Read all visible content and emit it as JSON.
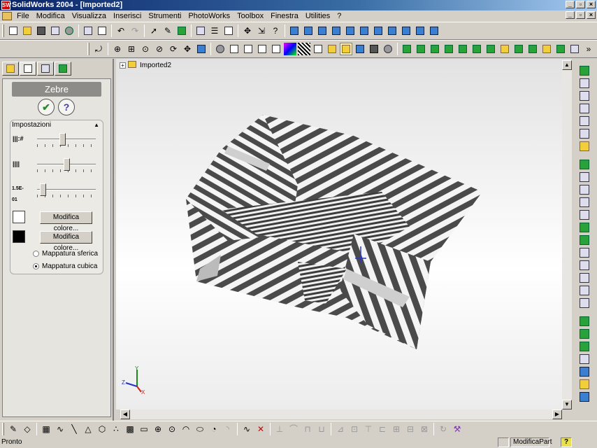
{
  "window": {
    "title": "SolidWorks 2004 - [Imported2]",
    "app_icon": "solidworks-logo-icon"
  },
  "menu": {
    "items": [
      "File",
      "Modifica",
      "Visualizza",
      "Inserisci",
      "Strumenti",
      "PhotoWorks",
      "Toolbox",
      "Finestra",
      "Utilities",
      "?"
    ]
  },
  "tree": {
    "root_label": "Imported2"
  },
  "property_manager": {
    "title": "Zebre",
    "ok_glyph": "✔",
    "help_glyph": "?",
    "group_title": "Impostazioni",
    "slider1_icon_text": "|||:#",
    "slider2_icon_text": "||||",
    "slider3_icon_text": "1.5E-01",
    "slider1_value": 0.42,
    "slider2_value": 0.5,
    "slider3_value": 0.05,
    "color1_button": "Modifica colore...",
    "color2_button": "Modifica colore...",
    "color1": "#ffffff",
    "color2": "#000000",
    "radio_spherical": "Mappatura sferica",
    "radio_cubic": "Mappatura cubica",
    "selected_mapping": "cubic"
  },
  "triad": {
    "x": "X",
    "y": "Y",
    "z": "Z"
  },
  "status": {
    "left": "Pronto",
    "mode": "ModificaPart",
    "help": "?"
  },
  "colors": {
    "chrome": "#d4d0c8",
    "title_start": "#0a246a",
    "title_end": "#a6caf0",
    "stripe_dark": "#4a4a4a",
    "stripe_light": "#f4f4f4"
  }
}
